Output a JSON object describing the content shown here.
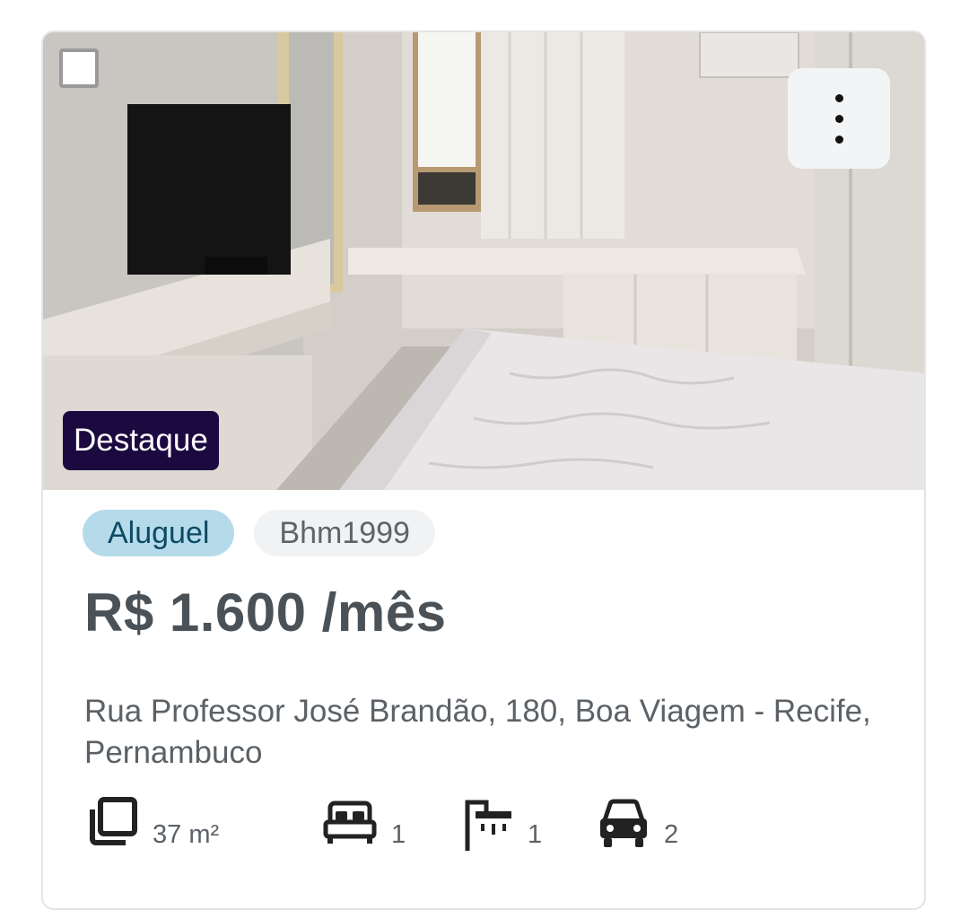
{
  "listing": {
    "badge": "Destaque",
    "purpose": "Aluguel",
    "code": "Bhm1999",
    "price": "R$ 1.600 /mês",
    "address": "Rua Professor José Brandão, 180, Boa Viagem - Recife, Pernambuco",
    "features": {
      "area": "37 m²",
      "bedrooms": "1",
      "bathrooms": "1",
      "parking": "2"
    },
    "photo": {
      "icon": "property-photo"
    },
    "actions": {
      "select_icon": "checkbox",
      "more_icon": "more-vertical-icon"
    }
  },
  "colors": {
    "badge_bg": "#1b0940",
    "tag_type_bg": "#b5dbea",
    "tag_type_text": "#0d4a63",
    "tag_code_bg": "#f1f2f3",
    "price_text": "#4a5258"
  }
}
